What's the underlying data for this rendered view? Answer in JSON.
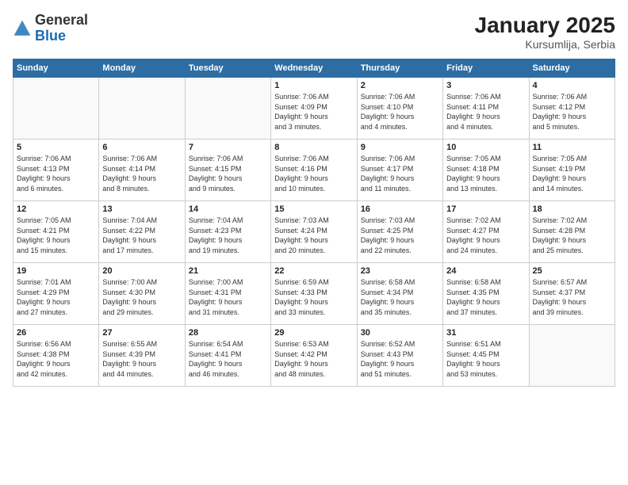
{
  "header": {
    "logo_general": "General",
    "logo_blue": "Blue",
    "title": "January 2025",
    "subtitle": "Kursumlija, Serbia"
  },
  "days_of_week": [
    "Sunday",
    "Monday",
    "Tuesday",
    "Wednesday",
    "Thursday",
    "Friday",
    "Saturday"
  ],
  "weeks": [
    [
      {
        "day": "",
        "info": ""
      },
      {
        "day": "",
        "info": ""
      },
      {
        "day": "",
        "info": ""
      },
      {
        "day": "1",
        "info": "Sunrise: 7:06 AM\nSunset: 4:09 PM\nDaylight: 9 hours\nand 3 minutes."
      },
      {
        "day": "2",
        "info": "Sunrise: 7:06 AM\nSunset: 4:10 PM\nDaylight: 9 hours\nand 4 minutes."
      },
      {
        "day": "3",
        "info": "Sunrise: 7:06 AM\nSunset: 4:11 PM\nDaylight: 9 hours\nand 4 minutes."
      },
      {
        "day": "4",
        "info": "Sunrise: 7:06 AM\nSunset: 4:12 PM\nDaylight: 9 hours\nand 5 minutes."
      }
    ],
    [
      {
        "day": "5",
        "info": "Sunrise: 7:06 AM\nSunset: 4:13 PM\nDaylight: 9 hours\nand 6 minutes."
      },
      {
        "day": "6",
        "info": "Sunrise: 7:06 AM\nSunset: 4:14 PM\nDaylight: 9 hours\nand 8 minutes."
      },
      {
        "day": "7",
        "info": "Sunrise: 7:06 AM\nSunset: 4:15 PM\nDaylight: 9 hours\nand 9 minutes."
      },
      {
        "day": "8",
        "info": "Sunrise: 7:06 AM\nSunset: 4:16 PM\nDaylight: 9 hours\nand 10 minutes."
      },
      {
        "day": "9",
        "info": "Sunrise: 7:06 AM\nSunset: 4:17 PM\nDaylight: 9 hours\nand 11 minutes."
      },
      {
        "day": "10",
        "info": "Sunrise: 7:05 AM\nSunset: 4:18 PM\nDaylight: 9 hours\nand 13 minutes."
      },
      {
        "day": "11",
        "info": "Sunrise: 7:05 AM\nSunset: 4:19 PM\nDaylight: 9 hours\nand 14 minutes."
      }
    ],
    [
      {
        "day": "12",
        "info": "Sunrise: 7:05 AM\nSunset: 4:21 PM\nDaylight: 9 hours\nand 15 minutes."
      },
      {
        "day": "13",
        "info": "Sunrise: 7:04 AM\nSunset: 4:22 PM\nDaylight: 9 hours\nand 17 minutes."
      },
      {
        "day": "14",
        "info": "Sunrise: 7:04 AM\nSunset: 4:23 PM\nDaylight: 9 hours\nand 19 minutes."
      },
      {
        "day": "15",
        "info": "Sunrise: 7:03 AM\nSunset: 4:24 PM\nDaylight: 9 hours\nand 20 minutes."
      },
      {
        "day": "16",
        "info": "Sunrise: 7:03 AM\nSunset: 4:25 PM\nDaylight: 9 hours\nand 22 minutes."
      },
      {
        "day": "17",
        "info": "Sunrise: 7:02 AM\nSunset: 4:27 PM\nDaylight: 9 hours\nand 24 minutes."
      },
      {
        "day": "18",
        "info": "Sunrise: 7:02 AM\nSunset: 4:28 PM\nDaylight: 9 hours\nand 25 minutes."
      }
    ],
    [
      {
        "day": "19",
        "info": "Sunrise: 7:01 AM\nSunset: 4:29 PM\nDaylight: 9 hours\nand 27 minutes."
      },
      {
        "day": "20",
        "info": "Sunrise: 7:00 AM\nSunset: 4:30 PM\nDaylight: 9 hours\nand 29 minutes."
      },
      {
        "day": "21",
        "info": "Sunrise: 7:00 AM\nSunset: 4:31 PM\nDaylight: 9 hours\nand 31 minutes."
      },
      {
        "day": "22",
        "info": "Sunrise: 6:59 AM\nSunset: 4:33 PM\nDaylight: 9 hours\nand 33 minutes."
      },
      {
        "day": "23",
        "info": "Sunrise: 6:58 AM\nSunset: 4:34 PM\nDaylight: 9 hours\nand 35 minutes."
      },
      {
        "day": "24",
        "info": "Sunrise: 6:58 AM\nSunset: 4:35 PM\nDaylight: 9 hours\nand 37 minutes."
      },
      {
        "day": "25",
        "info": "Sunrise: 6:57 AM\nSunset: 4:37 PM\nDaylight: 9 hours\nand 39 minutes."
      }
    ],
    [
      {
        "day": "26",
        "info": "Sunrise: 6:56 AM\nSunset: 4:38 PM\nDaylight: 9 hours\nand 42 minutes."
      },
      {
        "day": "27",
        "info": "Sunrise: 6:55 AM\nSunset: 4:39 PM\nDaylight: 9 hours\nand 44 minutes."
      },
      {
        "day": "28",
        "info": "Sunrise: 6:54 AM\nSunset: 4:41 PM\nDaylight: 9 hours\nand 46 minutes."
      },
      {
        "day": "29",
        "info": "Sunrise: 6:53 AM\nSunset: 4:42 PM\nDaylight: 9 hours\nand 48 minutes."
      },
      {
        "day": "30",
        "info": "Sunrise: 6:52 AM\nSunset: 4:43 PM\nDaylight: 9 hours\nand 51 minutes."
      },
      {
        "day": "31",
        "info": "Sunrise: 6:51 AM\nSunset: 4:45 PM\nDaylight: 9 hours\nand 53 minutes."
      },
      {
        "day": "",
        "info": ""
      }
    ]
  ]
}
